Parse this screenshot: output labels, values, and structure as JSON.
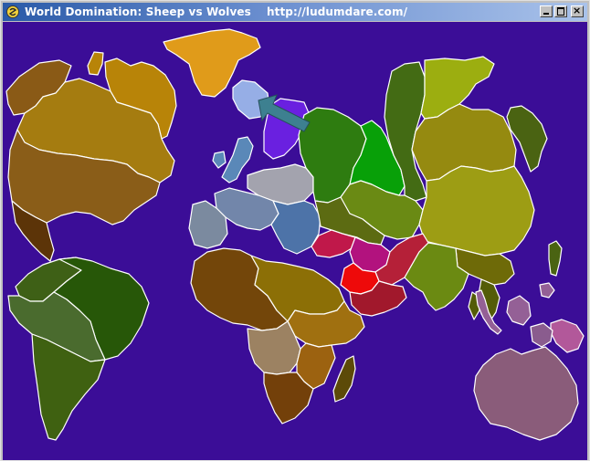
{
  "window": {
    "title": "World Domination: Sheep vs Wolves    http://ludumdare.com/",
    "app_icon": "pygame-snake-icon"
  },
  "controls": {
    "minimize_icon": "minimize-icon",
    "maximize_icon": "maximize-icon",
    "close_icon": "close-icon",
    "close_glyph": "×"
  },
  "map": {
    "background_color": "#3b0d97",
    "border_color": "#ffffff",
    "cursor_icon": "arrow-cursor-icon",
    "cursor_color": "#3d8090",
    "territories": [
      {
        "name": "alaska",
        "color": "#8a5a16"
      },
      {
        "name": "canada-north",
        "color": "#b88408"
      },
      {
        "name": "arctic-islands",
        "color": "#b88408"
      },
      {
        "name": "greenland",
        "color": "#e09b1a"
      },
      {
        "name": "canada",
        "color": "#a57c10"
      },
      {
        "name": "usa",
        "color": "#8a5d18"
      },
      {
        "name": "mexico",
        "color": "#5c3408"
      },
      {
        "name": "colombia",
        "color": "#3e6016"
      },
      {
        "name": "amazon",
        "color": "#275708"
      },
      {
        "name": "peru",
        "color": "#4a6b2e"
      },
      {
        "name": "argentina",
        "color": "#3f6111"
      },
      {
        "name": "iceland",
        "color": "#96aee6"
      },
      {
        "name": "scandinavia",
        "color": "#6a20e0"
      },
      {
        "name": "uk",
        "color": "#5a88b8"
      },
      {
        "name": "northern-europe",
        "color": "#a3a3ae"
      },
      {
        "name": "western-europe",
        "color": "#7286aa"
      },
      {
        "name": "iberia",
        "color": "#7b8a9f"
      },
      {
        "name": "eastern-europe",
        "color": "#4d73a8"
      },
      {
        "name": "ukraine",
        "color": "#2e7c10"
      },
      {
        "name": "urals",
        "color": "#08a008"
      },
      {
        "name": "siberia",
        "color": "#436b14"
      },
      {
        "name": "yakutsk",
        "color": "#9cae10"
      },
      {
        "name": "kamchatka",
        "color": "#4a6312"
      },
      {
        "name": "irkutsk",
        "color": "#958a10"
      },
      {
        "name": "kazakhstan",
        "color": "#6a8a14"
      },
      {
        "name": "mongolia",
        "color": "#9d9d14"
      },
      {
        "name": "japan",
        "color": "#4a6312"
      },
      {
        "name": "caucasus",
        "color": "#5c6b12"
      },
      {
        "name": "balkans",
        "color": "#c0184a"
      },
      {
        "name": "turkey",
        "color": "#b2127e"
      },
      {
        "name": "iran",
        "color": "#b52038"
      },
      {
        "name": "middle-east",
        "color": "#ee0a0a"
      },
      {
        "name": "arabia",
        "color": "#a1182c"
      },
      {
        "name": "china",
        "color": "#6e6a08"
      },
      {
        "name": "india",
        "color": "#6b8a12"
      },
      {
        "name": "indochina",
        "color": "#545c08"
      },
      {
        "name": "north-africa",
        "color": "#73460a"
      },
      {
        "name": "egypt-sudan",
        "color": "#8c6f06"
      },
      {
        "name": "east-africa",
        "color": "#a07010"
      },
      {
        "name": "congo",
        "color": "#9c8262"
      },
      {
        "name": "southern-africa",
        "color": "#73400a"
      },
      {
        "name": "mozambique",
        "color": "#9c6210"
      },
      {
        "name": "madagascar",
        "color": "#5c4a08"
      },
      {
        "name": "indonesia",
        "color": "#946096"
      },
      {
        "name": "new-guinea",
        "color": "#b2589a"
      },
      {
        "name": "philippines",
        "color": "#8a5c8e"
      },
      {
        "name": "australia",
        "color": "#8a5c7a"
      }
    ]
  }
}
